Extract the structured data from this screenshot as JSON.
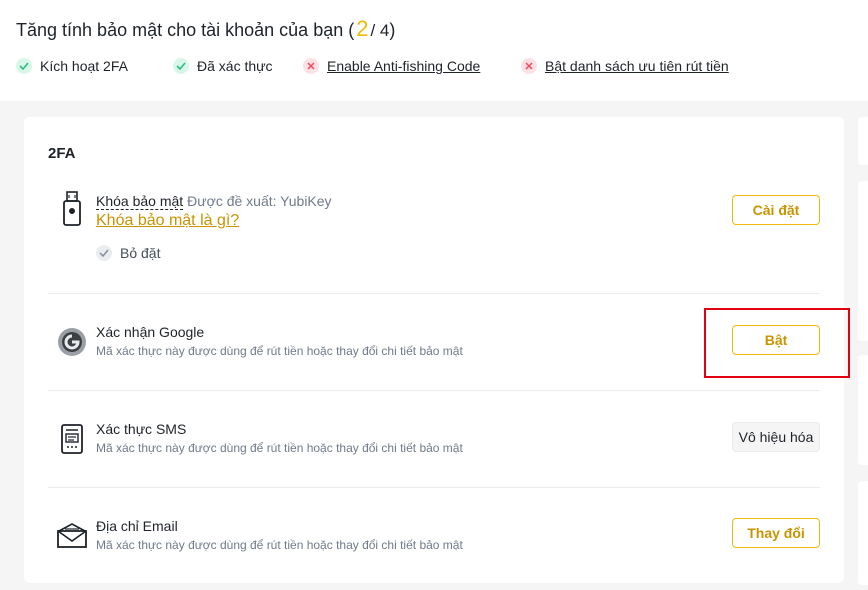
{
  "header": {
    "title_prefix": "Tăng tính bảo mật cho tài khoản của bạn (",
    "progress_current": "2",
    "progress_total": "/ 4",
    "title_suffix": ")",
    "checks": [
      {
        "label": "Kích hoạt 2FA",
        "status": "done",
        "icon": "check-icon"
      },
      {
        "label": "Đã xác thực",
        "status": "done",
        "icon": "check-icon"
      },
      {
        "label": "Enable Anti-fishing Code",
        "status": "todo",
        "icon": "cross-icon"
      },
      {
        "label": "Bật danh sách ưu tiên rút tiền",
        "status": "todo",
        "icon": "cross-icon"
      }
    ]
  },
  "section": {
    "title": "2FA",
    "items": [
      {
        "name": "Khóa bảo mật",
        "recommendation": "Được đề xuất: YubiKey",
        "link": "Khóa bảo mật là gì?",
        "skip_label": "Bỏ đặt",
        "button": "Cài đặt",
        "icon": "security-key-icon"
      },
      {
        "name": "Xác nhận Google",
        "description": "Mã xác thực này được dùng để rút tiền hoặc thay đổi chi tiết bảo mật",
        "button": "Bật",
        "icon": "google-authenticator-icon"
      },
      {
        "name": "Xác thực SMS",
        "description": "Mã xác thực này được dùng để rút tiền hoặc thay đổi chi tiết bảo mật",
        "button": "Vô hiệu hóa",
        "icon": "sms-icon"
      },
      {
        "name": "Địa chỉ Email",
        "description": "Mã xác thực này được dùng để rút tiền hoặc thay đổi chi tiết bảo mật",
        "button": "Thay đổi",
        "icon": "email-icon"
      }
    ]
  },
  "colors": {
    "accent": "#f0b90b",
    "accent_text": "#c99400",
    "success_bg": "#d9f6ea",
    "error_bg": "#fde1e4",
    "highlight": "#e0000f"
  }
}
